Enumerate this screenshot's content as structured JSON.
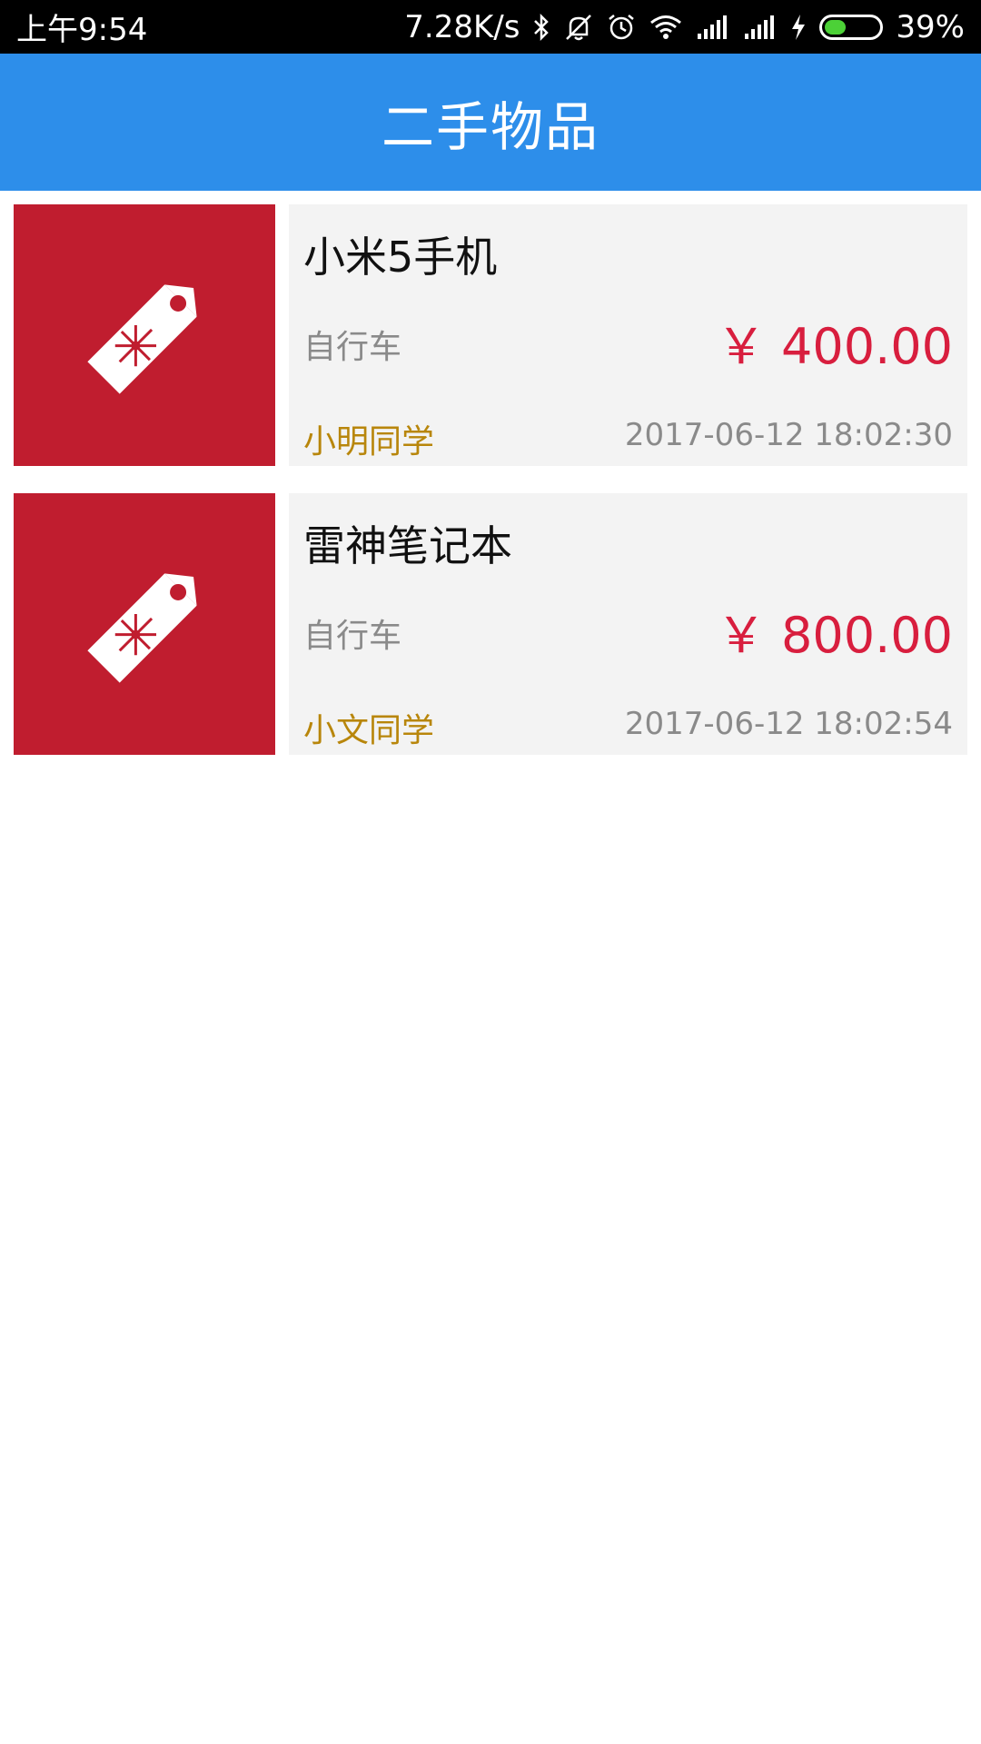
{
  "status_bar": {
    "time": "上午9:54",
    "speed": "7.28K/s",
    "battery": "39%",
    "battery_level": 0.39,
    "icons": [
      "bluetooth-icon",
      "mute-icon",
      "alarm-icon",
      "wifi-icon",
      "signal-icon",
      "signal-icon",
      "charging-icon",
      "battery-icon"
    ]
  },
  "app_bar": {
    "title": "二手物品"
  },
  "items": [
    {
      "title": "小米5手机",
      "category": "自行车",
      "price": "￥ 400.00",
      "seller": "小明同学",
      "time": "2017-06-12 18:02:30",
      "icon": "price-tag-icon"
    },
    {
      "title": "雷神笔记本",
      "category": "自行车",
      "price": "￥ 800.00",
      "seller": "小文同学",
      "time": "2017-06-12 18:02:54",
      "icon": "price-tag-icon"
    }
  ],
  "colors": {
    "app_bar": "#2d8eea",
    "thumb_bg": "#c01d2f",
    "price": "#d81e3e",
    "seller": "#b8860b"
  }
}
